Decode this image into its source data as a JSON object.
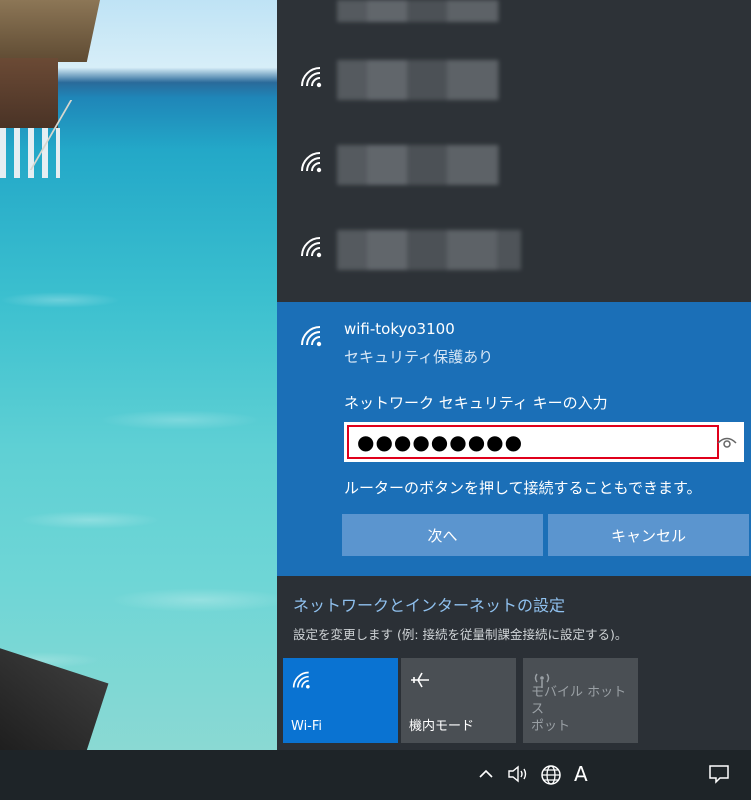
{
  "network_list": {
    "items": [
      {
        "icon": "wifi-signal-icon",
        "name_hidden": true
      },
      {
        "icon": "wifi-signal-icon",
        "name_hidden": true
      },
      {
        "icon": "wifi-signal-icon",
        "name_hidden": true
      }
    ]
  },
  "selected_network": {
    "ssid": "wifi-tokyo3100",
    "status": "セキュリティ保護あり",
    "key_label": "ネットワーク セキュリティ キーの入力",
    "password_masked": "●●●●●●●●●",
    "hint": "ルーターのボタンを押して接続することもできます。",
    "next_button": "次へ",
    "cancel_button": "キャンセル"
  },
  "settings": {
    "title": "ネットワークとインターネットの設定",
    "subtitle": "設定を変更します (例: 接続を従量制課金接続に設定する)。"
  },
  "quick_actions": [
    {
      "label": "Wi-Fi",
      "icon": "wifi-icon",
      "state": "on"
    },
    {
      "label": "機内モード",
      "icon": "airplane-icon",
      "state": "off"
    },
    {
      "label": "モバイル ホットスポット",
      "label_line1": "モバイル ホットス",
      "label_line2": "ポット",
      "icon": "hotspot-icon",
      "state": "disabled"
    }
  ],
  "taskbar": {
    "ime_indicator": "A",
    "icons": [
      "chevron-up-icon",
      "volume-icon",
      "network-globe-icon",
      "notification-icon"
    ]
  },
  "colors": {
    "accent": "#1b6fb7",
    "tile_active": "#0a73d2",
    "highlight_border": "#e0001b"
  }
}
